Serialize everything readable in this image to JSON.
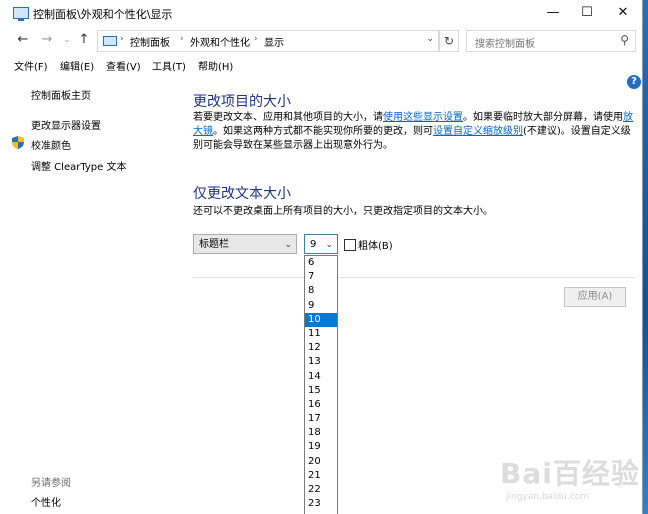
{
  "window": {
    "title": "控制面板\\外观和个性化\\显示",
    "minimize": "—",
    "maximize": "☐",
    "close": "✕"
  },
  "address": {
    "segments": [
      "控制面板",
      "外观和个性化",
      "显示"
    ],
    "search_placeholder": "搜索控制面板"
  },
  "menu": {
    "items": [
      "文件(F)",
      "编辑(E)",
      "查看(V)",
      "工具(T)",
      "帮助(H)"
    ]
  },
  "sidebar": {
    "home": "控制面板主页",
    "links": [
      "更改显示器设置",
      "校准颜色",
      "调整 ClearType 文本"
    ],
    "see_also_title": "另请参阅",
    "see_also": [
      "个性化"
    ]
  },
  "main": {
    "section1_title": "更改项目的大小",
    "section1_p1": "若要更改文本、应用和其他项目的大小，请",
    "section1_link1": "使用这些显示设置",
    "section1_p2": "。如果要临时放大部分屏幕，请使用",
    "section1_link2a": "放",
    "section1_link2b": "大镜",
    "section1_p3": "。如果这两种方式都不能实现你所要的更改，则可",
    "section1_link3": "设置自定义缩放级别",
    "section1_p4": "(不建议)。设置自定义级",
    "section1_p5": "别可能会导致在某些显示器上出现意外行为。",
    "section2_title": "仅更改文本大小",
    "section2_desc": "还可以不更改桌面上所有项目的大小，只更改指定项目的文本大小。",
    "item_select_value": "标题栏",
    "size_select_value": "9",
    "bold_label": "粗体(B)",
    "bold_checked": false,
    "apply_label": "应用(A)"
  },
  "size_dropdown": {
    "options": [
      "6",
      "7",
      "8",
      "9",
      "10",
      "11",
      "12",
      "13",
      "14",
      "15",
      "16",
      "17",
      "18",
      "19",
      "20",
      "21",
      "22",
      "23"
    ],
    "highlighted": "10"
  },
  "watermark": {
    "text": "Bai百经验",
    "sub": "jingyan.baidu.com"
  },
  "colors": {
    "heading": "#1e3287",
    "link": "#0066cc",
    "highlight": "#0078d7"
  }
}
